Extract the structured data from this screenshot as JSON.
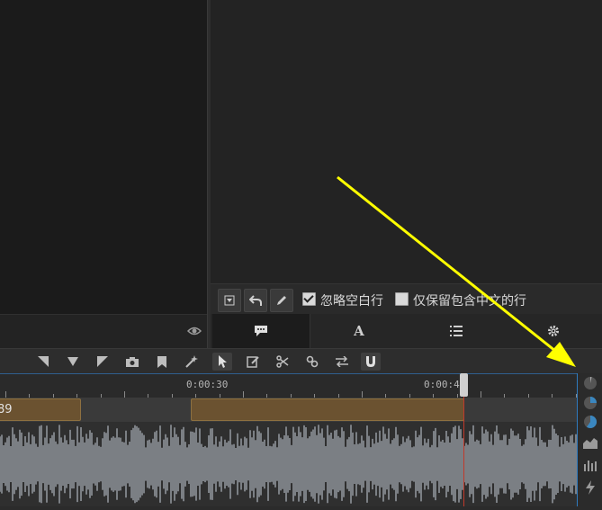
{
  "subtitle_toolbar": {
    "ignore_blank_lines_label": "忽略空白行",
    "ignore_blank_lines_checked": true,
    "keep_chinese_only_label": "仅保留包含中文的行",
    "keep_chinese_only_checked": false
  },
  "panel_tabs": [
    {
      "icon": "speech-bubble-icon",
      "active": true
    },
    {
      "icon": "font-a-icon",
      "active": false
    },
    {
      "icon": "list-icon",
      "active": false
    },
    {
      "icon": "gear-icon",
      "active": false
    }
  ],
  "timeline": {
    "time_labels": [
      "0:00:30",
      "0:00:40"
    ],
    "clips": [
      {
        "text": "89"
      },
      {
        "text": ""
      }
    ]
  },
  "colors": {
    "accent_blue": "#2f7bbf",
    "playhead_red": "#c0392b",
    "clip_brown": "#6b5230",
    "annotation_arrow": "#ffff00"
  }
}
